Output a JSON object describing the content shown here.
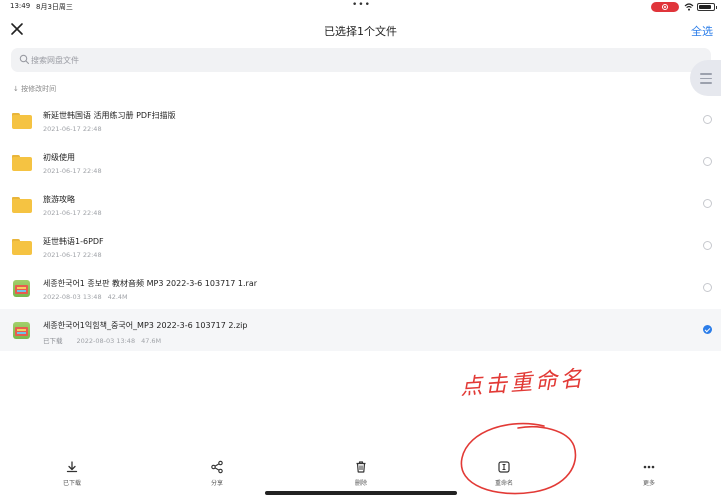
{
  "status_bar": {
    "time": "13:49",
    "date": "8月3日周三",
    "dots": "•••",
    "battery_level": 0.85,
    "record_color": "#e0353b"
  },
  "header": {
    "title": "已选择1个文件",
    "select_all": "全选"
  },
  "search": {
    "placeholder": "搜索网盘文件"
  },
  "sort": {
    "label": "↓ 按修改时间"
  },
  "files": [
    {
      "name": "新延世韩国语 活用练习册 PDF扫描版",
      "date": "2021-06-17 22:48",
      "icon": "folder-icon",
      "selected": false
    },
    {
      "name": "初级使用",
      "date": "2021-06-17 22:48",
      "icon": "folder-icon",
      "selected": false
    },
    {
      "name": "旅游攻略",
      "date": "2021-06-17 22:48",
      "icon": "folder-icon",
      "selected": false
    },
    {
      "name": "延世韩语1-6PDF",
      "date": "2021-06-17 22:48",
      "icon": "folder-icon",
      "selected": false
    },
    {
      "name": "세종한국어1 종보판 教材音频 MP3 2022-3-6 103717 1.rar",
      "date": "2022-08-03 13:48",
      "size": "42.4M",
      "icon": "archive-icon",
      "selected": false
    },
    {
      "name": "세종한국어1익힘책_중국어_MP3 2022-3-6 103717 2.zip",
      "status": "已下载",
      "date": "2022-08-03 13:48",
      "size": "47.6M",
      "icon": "archive-icon",
      "selected": true
    }
  ],
  "annotation": {
    "text": "点击重命名",
    "color": "#e23a36"
  },
  "toolbar": {
    "download": "已下载",
    "share": "分享",
    "delete": "删除",
    "rename": "重命名",
    "more": "更多"
  },
  "colors": {
    "accent": "#2b7de9",
    "folder": "#f5c342"
  }
}
